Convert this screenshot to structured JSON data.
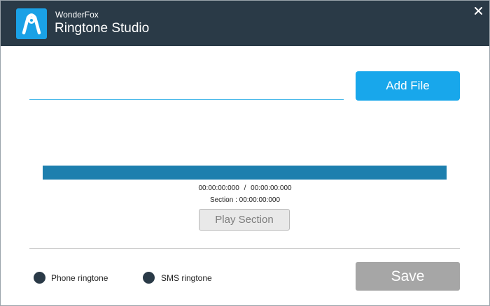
{
  "window": {
    "brand": "WonderFox",
    "title": "Ringtone Studio",
    "close_icon": "close-icon",
    "logo_icon": "ringtone-studio-logo-icon",
    "colors": {
      "titlebar": "#2a3a47",
      "accent": "#18a7eb",
      "waveform": "#1d7fae"
    }
  },
  "file": {
    "value": "",
    "add_file_label": "Add File"
  },
  "player": {
    "current_time": "00:00:00:000",
    "separator": "/",
    "total_time": "00:00:00:000",
    "section": "Section : 00:00:00:000",
    "play_section_label": "Play Section"
  },
  "options": {
    "phone_ringtone_label": "Phone ringtone",
    "sms_ringtone_label": "SMS ringtone"
  },
  "actions": {
    "save_label": "Save"
  }
}
